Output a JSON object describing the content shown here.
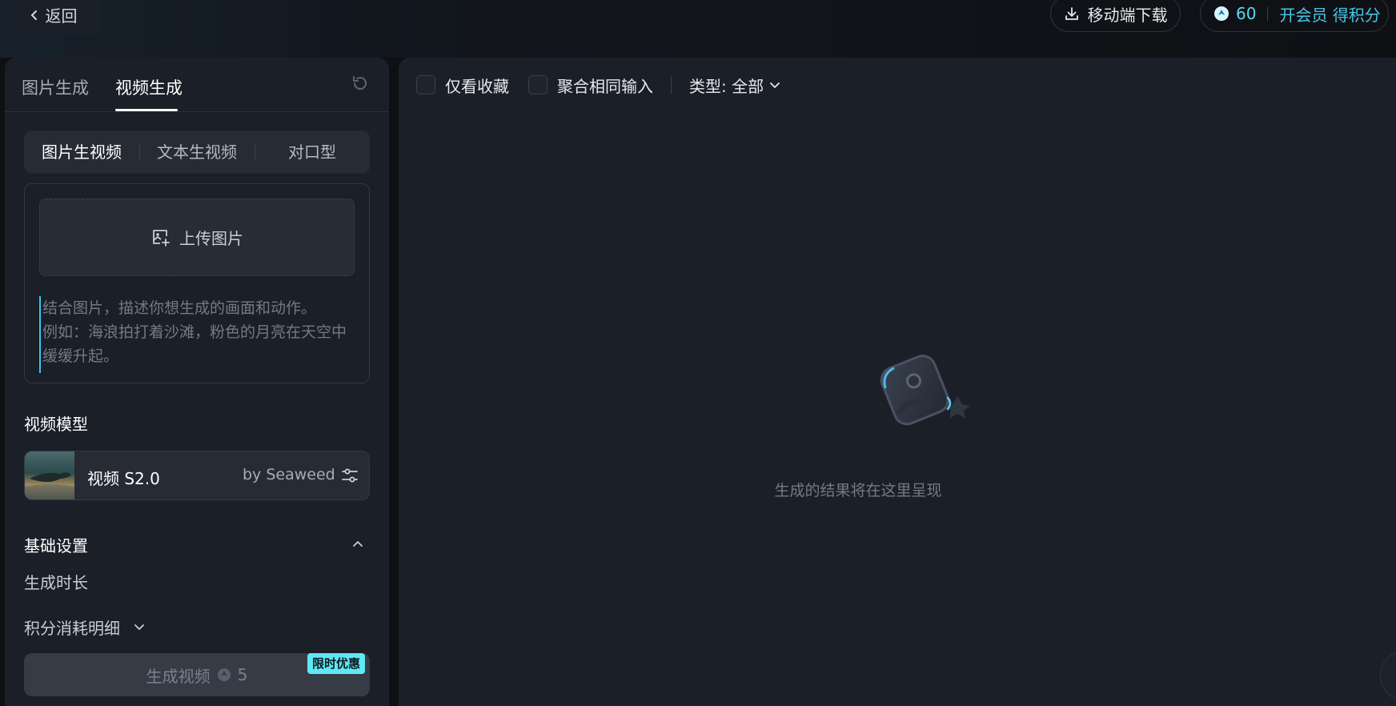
{
  "header": {
    "back_label": "返回",
    "download_label": "移动端下载",
    "points": "60",
    "vip_label": "开会员 得积分"
  },
  "left": {
    "tabs": [
      "图片生成",
      "视频生成"
    ],
    "active_tab": "视频生成",
    "modes": [
      "图片生视频",
      "文本生视频",
      "对口型"
    ],
    "active_mode": "图片生视频",
    "upload_label": "上传图片",
    "prompt_placeholder": "结合图片，描述你想生成的画面和动作。\n例如：海浪拍打着沙滩，粉色的月亮在天空中缓缓升起。",
    "model_section_title": "视频模型",
    "model": {
      "name": "视频 S2.0",
      "by": "by Seaweed"
    },
    "basic_settings_title": "基础设置",
    "duration_label": "生成时长",
    "cost_detail_label": "积分消耗明细",
    "generate_label": "生成视频",
    "generate_cost": "5",
    "promo_badge": "限时优惠"
  },
  "right": {
    "filter_favorites": "仅看收藏",
    "filter_merge": "聚合相同输入",
    "type_filter": "类型: 全部",
    "empty_text": "生成的结果将在这里呈现"
  },
  "colors": {
    "accent": "#46c8e8",
    "promo": "#5ee8f4",
    "panel_bg": "#1b1f27",
    "page_bg": "#0f1014"
  }
}
